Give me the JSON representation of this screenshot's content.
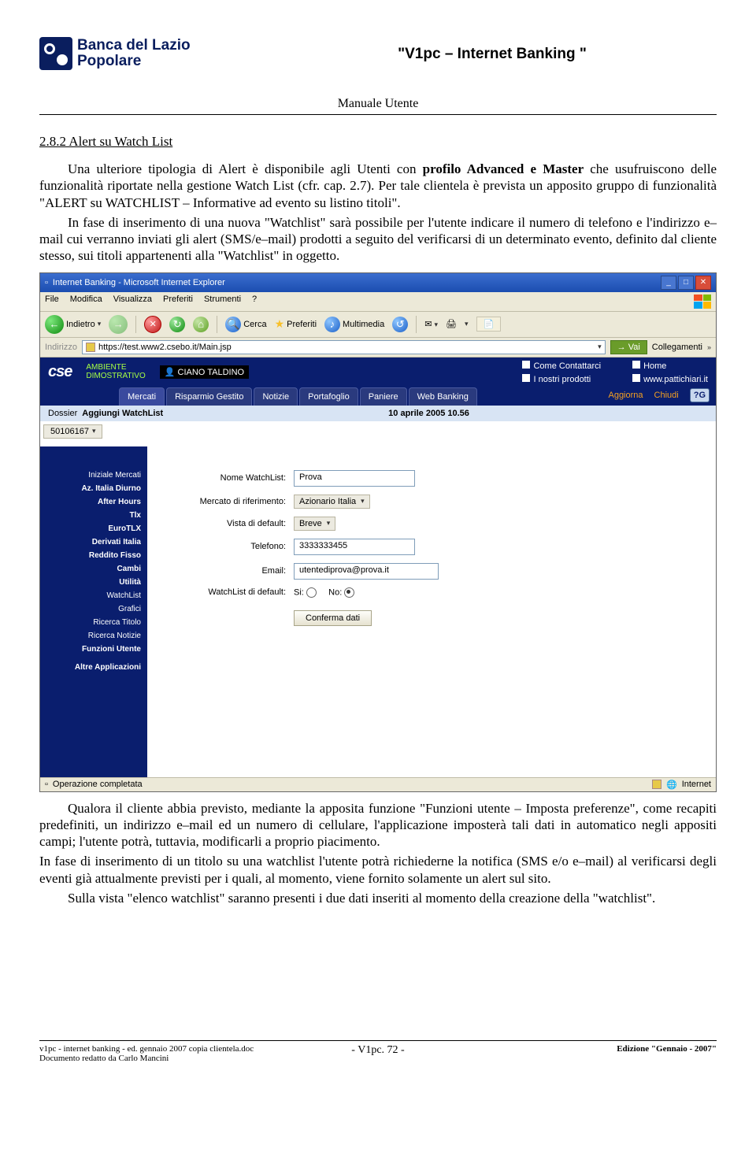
{
  "header": {
    "bank_line1": "Banca del Lazio",
    "bank_line2": "Popolare",
    "doc_title": "\"V1pc – Internet Banking \"",
    "sub_title": "Manuale Utente"
  },
  "section": {
    "number_title": "2.8.2    Alert su Watch List",
    "p1": "Una ulteriore tipologia di Alert è disponibile agli Utenti con profilo Advanced e Master che usufruiscono delle funzionalità riportate nella gestione Watch List (cfr. cap. 2.7). Per tale clientela è prevista un apposito gruppo di funzionalità \"ALERT su WATCHLIST – Informative ad evento su listino titoli\".",
    "p2": "In fase di inserimento di una nuova \"Watchlist\" sarà possibile per l'utente indicare il numero di telefono e l'indirizzo e–mail cui verranno inviati gli alert (SMS/e–mail) prodotti a seguito del verificarsi di un determinato evento, definito dal cliente stesso, sui titoli appartenenti alla \"Watchlist\" in oggetto.",
    "p3": "Qualora il cliente abbia previsto, mediante la apposita funzione \"Funzioni utente – Imposta preferenze\", come recapiti predefiniti, un indirizzo e–mail ed un numero di cellulare, l'applicazione imposterà tali dati in automatico negli appositi campi; l'utente potrà, tuttavia, modificarli a proprio piacimento.",
    "p4": "In fase di inserimento di un titolo su una watchlist l'utente potrà richiederne la notifica (SMS e/o e–mail) al verificarsi degli eventi già attualmente previsti per i quali, al momento, viene fornito solamente un alert sul sito.",
    "p5": "Sulla vista \"elenco watchlist\" saranno presenti i due dati inseriti al momento della creazione della \"watchlist\"."
  },
  "ie": {
    "title": "Internet Banking - Microsoft Internet Explorer",
    "menu": {
      "file": "File",
      "modifica": "Modifica",
      "visualizza": "Visualizza",
      "preferiti": "Preferiti",
      "strumenti": "Strumenti",
      "help": "?"
    },
    "toolbar": {
      "indietro": "Indietro",
      "cerca": "Cerca",
      "preferiti": "Preferiti",
      "multimedia": "Multimedia"
    },
    "addr_label": "Indirizzo",
    "url": "https://test.www2.csebo.it/Main.jsp",
    "go": "Vai",
    "links": "Collegamenti",
    "status_left": "Operazione completata",
    "status_right": "Internet"
  },
  "app": {
    "ambiente_line1": "AMBIENTE",
    "ambiente_line2": "DIMOSTRATIVO",
    "user": "CIANO TALDINO",
    "link_contattarci": "Come Contattarci",
    "link_home": "Home",
    "link_prodotti": "I nostri prodotti",
    "link_pattichiari": "www.pattichiari.it",
    "tabs": {
      "mercati": "Mercati",
      "risparmio": "Risparmio Gestito",
      "notizie": "Notizie",
      "portafoglio": "Portafoglio",
      "paniere": "Paniere",
      "web": "Web Banking"
    },
    "actions": {
      "aggiorna": "Aggiorna",
      "chiudi": "Chiudi"
    },
    "dossier_label": "Dossier",
    "dossier_title": "Aggiungi WatchList",
    "timestamp": "10 aprile 2005 10.56",
    "code": "50106167",
    "side": [
      "Iniziale Mercati",
      "Az. Italia Diurno",
      "After Hours",
      "Tlx",
      "EuroTLX",
      "Derivati Italia",
      "Reddito Fisso",
      "Cambi",
      "Utilità",
      "WatchList",
      "Grafici",
      "Ricerca Titolo",
      "Ricerca Notizie",
      "Funzioni Utente",
      "Altre Applicazioni"
    ],
    "form": {
      "label_nome": "Nome WatchList:",
      "val_nome": "Prova",
      "label_mercato": "Mercato di riferimento:",
      "val_mercato": "Azionario Italia",
      "label_vista": "Vista di default:",
      "val_vista": "Breve",
      "label_telefono": "Telefono:",
      "val_telefono": "3333333455",
      "label_email": "Email:",
      "val_email": "utentediprova@prova.it",
      "label_default": "WatchList di default:",
      "radio_si": "Si:",
      "radio_no": "No:",
      "confirm": "Conferma dati"
    }
  },
  "footer": {
    "left_line1": "v1pc - internet banking - ed. gennaio 2007 copia clientela.doc",
    "left_line2": "Documento redatto da Carlo Mancini",
    "center": "- V1pc. 72 -",
    "right": "Edizione \"Gennaio - 2007\""
  }
}
